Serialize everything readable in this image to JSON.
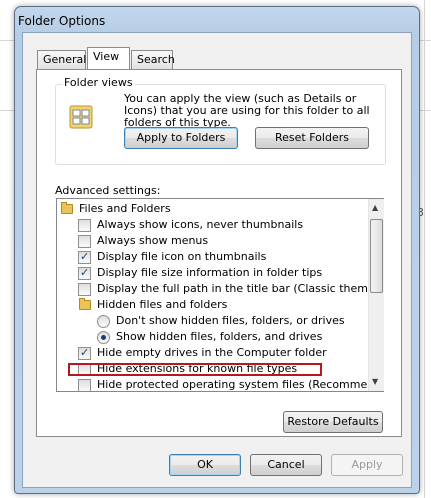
{
  "window": {
    "title": "Folder Options"
  },
  "tabs": [
    {
      "label": "General",
      "active": false
    },
    {
      "label": "View",
      "active": true
    },
    {
      "label": "Search",
      "active": false
    }
  ],
  "folder_views": {
    "label": "Folder views",
    "description": "You can apply the view (such as Details or Icons) that you are using for this folder to all folders of this type.",
    "apply_button": "Apply to Folders",
    "reset_button": "Reset Folders"
  },
  "advanced": {
    "label": "Advanced settings:",
    "items": [
      {
        "kind": "folder",
        "label": "Files and Folders"
      },
      {
        "kind": "checkbox",
        "checked": false,
        "label": "Always show icons, never thumbnails"
      },
      {
        "kind": "checkbox",
        "checked": false,
        "label": "Always show menus"
      },
      {
        "kind": "checkbox",
        "checked": true,
        "label": "Display file icon on thumbnails"
      },
      {
        "kind": "checkbox",
        "checked": true,
        "label": "Display file size information in folder tips"
      },
      {
        "kind": "checkbox",
        "checked": false,
        "label": "Display the full path in the title bar (Classic theme only)"
      },
      {
        "kind": "folder",
        "label": "Hidden files and folders"
      },
      {
        "kind": "radio",
        "checked": false,
        "label": "Don't show hidden files, folders, or drives"
      },
      {
        "kind": "radio",
        "checked": true,
        "label": "Show hidden files, folders, and drives"
      },
      {
        "kind": "checkbox",
        "checked": true,
        "label": "Hide empty drives in the Computer folder"
      },
      {
        "kind": "checkbox",
        "checked": false,
        "label": "Hide extensions for known file types"
      },
      {
        "kind": "checkbox",
        "checked": false,
        "label": "Hide protected operating system files (Recommended)"
      }
    ],
    "restore_button": "Restore Defaults"
  },
  "footer": {
    "ok": "OK",
    "cancel": "Cancel",
    "apply": "Apply"
  },
  "colors": {
    "highlight": "#b5191d",
    "window_frame": "#bcd2ea"
  },
  "background_fragment": "3"
}
